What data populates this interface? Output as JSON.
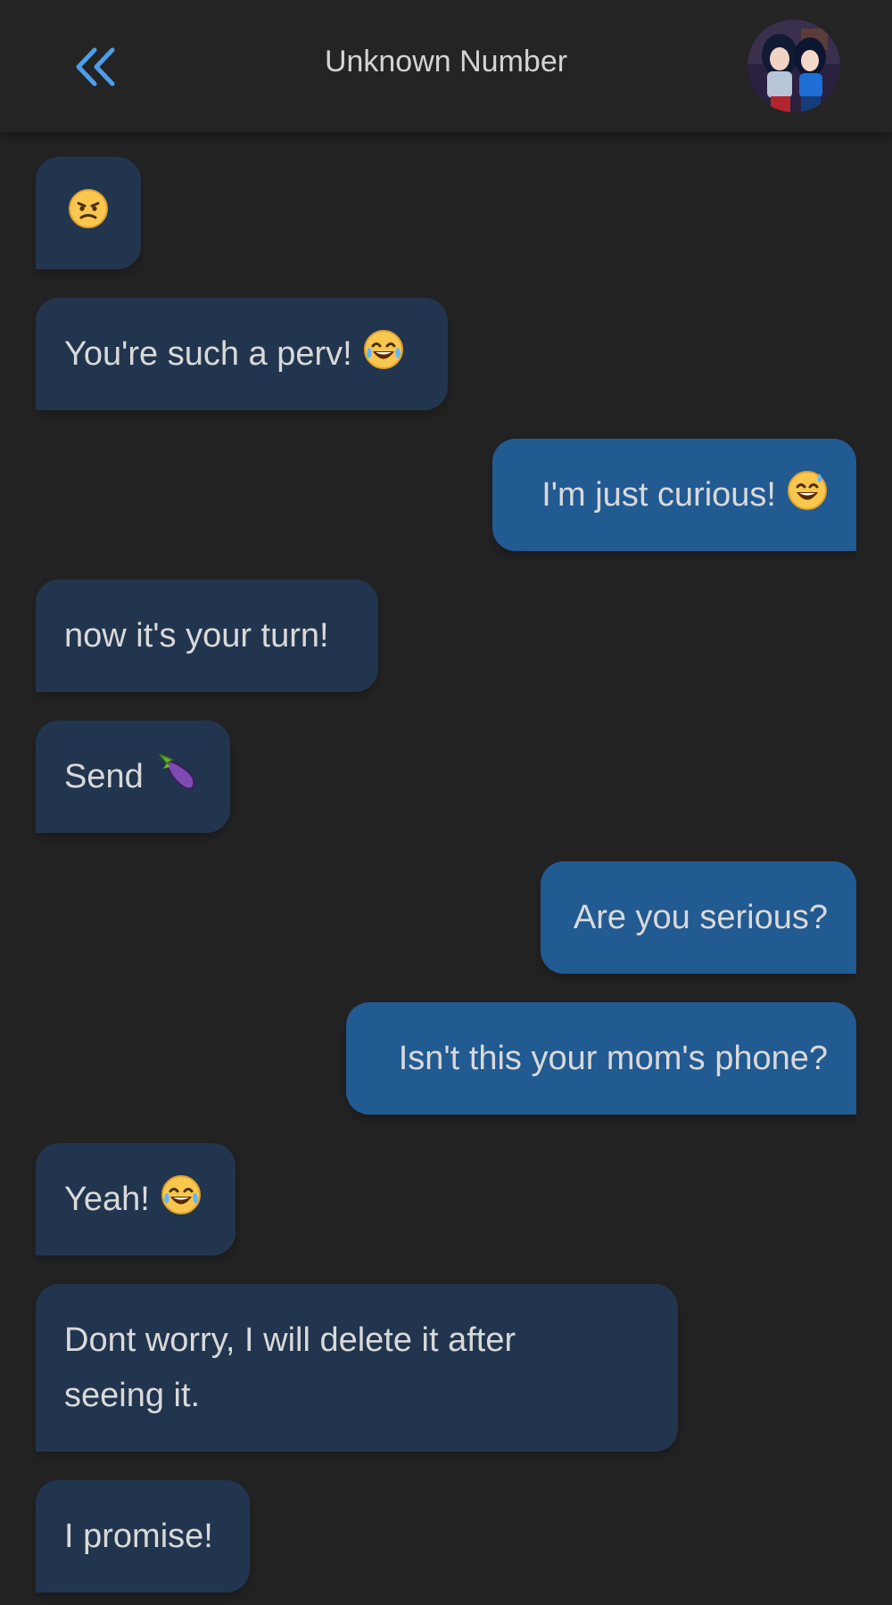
{
  "header": {
    "title": "Unknown Number"
  },
  "icons": {
    "back": "double-chevron-left-icon",
    "avatar": "contact-avatar"
  },
  "colors": {
    "background": "#232323",
    "incoming_bubble": "#22354e",
    "outgoing_bubble": "#225a92",
    "accent": "#4d9ee8"
  },
  "messages": [
    {
      "direction": "incoming",
      "text": "",
      "emoji": "angry-face-emoji"
    },
    {
      "direction": "incoming",
      "text": "You're such a perv!",
      "emoji": "tears-of-joy-emoji"
    },
    {
      "direction": "outgoing",
      "text": "I'm just curious!",
      "emoji": "grinning-sweat-emoji"
    },
    {
      "direction": "incoming",
      "text": "now it's your turn!"
    },
    {
      "direction": "incoming",
      "text": "Send",
      "emoji": "eggplant-emoji"
    },
    {
      "direction": "outgoing",
      "text": "Are you serious?"
    },
    {
      "direction": "outgoing",
      "text": "Isn't this your mom's phone?"
    },
    {
      "direction": "incoming",
      "text": "Yeah!",
      "emoji": "tears-of-joy-emoji"
    },
    {
      "direction": "incoming",
      "text": "Dont worry, I will delete it after seeing it."
    },
    {
      "direction": "incoming",
      "text": "I promise!"
    }
  ]
}
